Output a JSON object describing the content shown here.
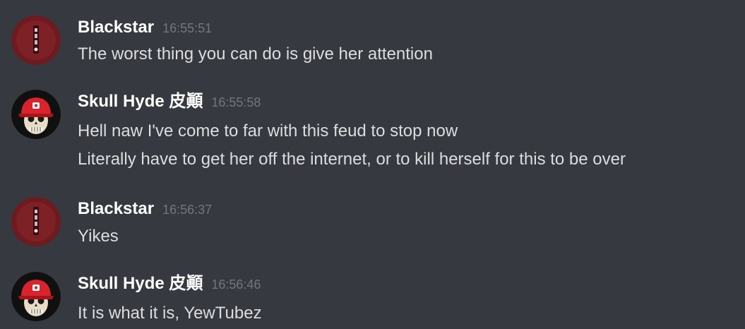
{
  "messages": [
    {
      "author": "Blackstar",
      "time": "16:55:51",
      "avatar_icon": "blackstar-avatar-icon",
      "lines": [
        "The worst thing you can do is give her attention"
      ]
    },
    {
      "author": "Skull Hyde 皮顚",
      "time": "16:55:58",
      "avatar_icon": "skull-cap-avatar-icon",
      "lines": [
        "Hell naw I've come to far with this feud to stop now",
        "Literally have to get her off the internet, or to kill herself for this to be over"
      ]
    },
    {
      "author": "Blackstar",
      "time": "16:56:37",
      "avatar_icon": "blackstar-avatar-icon",
      "lines": [
        "Yikes"
      ]
    },
    {
      "author": "Skull Hyde 皮顚",
      "time": "16:56:46",
      "avatar_icon": "skull-cap-avatar-icon",
      "lines": [
        "It is what it is, YewTubez"
      ]
    }
  ],
  "colors": {
    "background": "#36393f",
    "username": "#ffffff",
    "timestamp": "#72767d",
    "message_text": "#dcddde",
    "blackstar_avatar": "#7a1f24",
    "skull_cap": "#d8242c"
  }
}
